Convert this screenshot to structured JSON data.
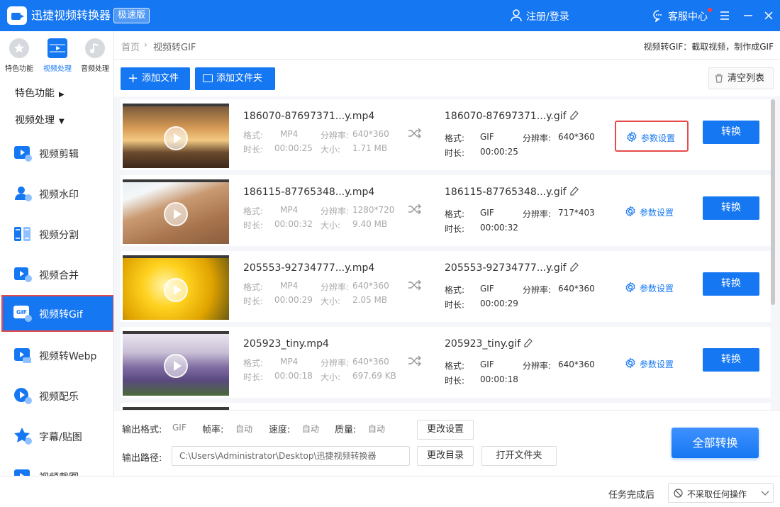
{
  "app": {
    "title": "迅捷视频转换器",
    "edition": "极速版",
    "login": "注册/登录",
    "support": "客服中心"
  },
  "topcats": [
    {
      "label": "特色功能",
      "icon": "star-icon"
    },
    {
      "label": "视频处理",
      "icon": "film-icon"
    },
    {
      "label": "音频处理",
      "icon": "music-icon"
    }
  ],
  "sidebar": {
    "sections": [
      "特色功能",
      "视频处理"
    ],
    "items": [
      {
        "label": "视频剪辑",
        "icon": "video-cut-icon"
      },
      {
        "label": "视频水印",
        "icon": "watermark-icon"
      },
      {
        "label": "视频分割",
        "icon": "split-icon"
      },
      {
        "label": "视频合并",
        "icon": "merge-icon"
      },
      {
        "label": "视频转Gif",
        "icon": "gif-icon",
        "active": true
      },
      {
        "label": "视频转Webp",
        "icon": "webp-icon"
      },
      {
        "label": "视频配乐",
        "icon": "music-video-icon"
      },
      {
        "label": "字幕/贴图",
        "icon": "subtitle-icon"
      },
      {
        "label": "视频截图",
        "icon": "screenshot-icon"
      }
    ]
  },
  "breadcrumb": {
    "home": "首页",
    "sep": "›",
    "current": "视频转GIF",
    "desc": "视频转GIF：截取视频，制作成GIF"
  },
  "toolbar": {
    "add_file": "添加文件",
    "add_folder": "添加文件夹",
    "clear": "清空列表"
  },
  "labels": {
    "format": "格式:",
    "resolution": "分辨率:",
    "duration": "时长:",
    "size": "大小:",
    "params": "参数设置",
    "convert": "转换"
  },
  "files": [
    {
      "src": "186070-87697371...y.mp4",
      "fmt": "MP4",
      "res": "640*360",
      "dur": "00:00:25",
      "size": "1.71 MB",
      "out": "186070-87697371...y.gif",
      "ofmt": "GIF",
      "ores": "640*360",
      "odur": "00:00:25",
      "thumb": "sunset"
    },
    {
      "src": "186115-87765348...y.mp4",
      "fmt": "MP4",
      "res": "1280*720",
      "dur": "00:00:32",
      "size": "9.40 MB",
      "out": "186115-87765348...y.gif",
      "ofmt": "GIF",
      "ores": "717*403",
      "odur": "00:00:32",
      "thumb": "beach"
    },
    {
      "src": "205553-92734777...y.mp4",
      "fmt": "MP4",
      "res": "640*360",
      "dur": "00:00:29",
      "size": "2.05 MB",
      "out": "205553-92734777...y.gif",
      "ofmt": "GIF",
      "ores": "640*360",
      "odur": "00:00:29",
      "thumb": "flowers"
    },
    {
      "src": "205923_tiny.mp4",
      "fmt": "MP4",
      "res": "640*360",
      "dur": "00:00:18",
      "size": "697.69 KB",
      "out": "205923_tiny.gif",
      "ofmt": "GIF",
      "ores": "640*360",
      "odur": "00:00:18",
      "thumb": "lavender"
    }
  ],
  "output": {
    "format_label": "输出格式:",
    "format": "GIF",
    "fps_label": "帧率:",
    "fps": "自动",
    "speed_label": "速度:",
    "speed": "自动",
    "quality_label": "质量:",
    "quality": "自动",
    "change_settings": "更改设置",
    "path_label": "输出路径:",
    "path": "C:\\Users\\Administrator\\Desktop\\迅捷视频转换器",
    "change_dir": "更改目录",
    "open_folder": "打开文件夹",
    "convert_all": "全部转换"
  },
  "footer": {
    "label": "任务完成后",
    "value": "不采取任何操作"
  },
  "colors": {
    "accent": "#1677f2",
    "highlight": "#e54b4b"
  }
}
